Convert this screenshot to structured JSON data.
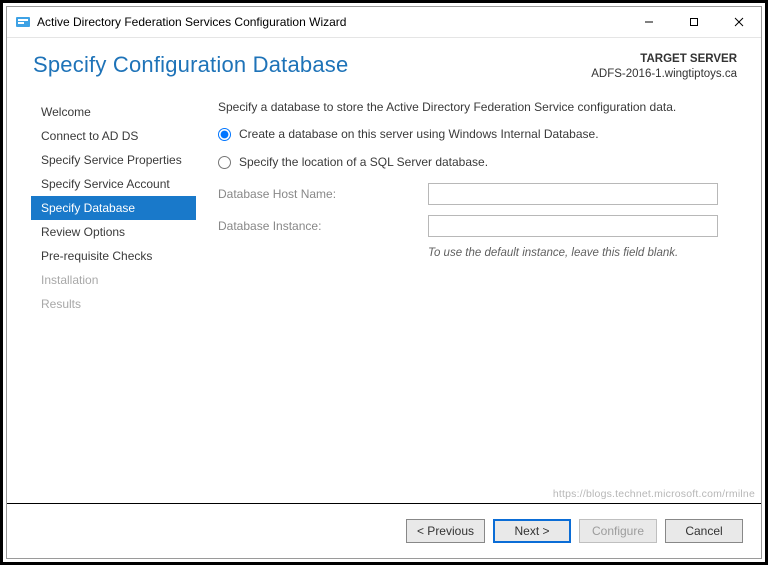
{
  "window": {
    "title": "Active Directory Federation Services Configuration Wizard"
  },
  "header": {
    "title": "Specify Configuration Database",
    "target_label": "TARGET SERVER",
    "target_value": "ADFS-2016-1.wingtiptoys.ca"
  },
  "sidebar": {
    "items": [
      {
        "label": "Welcome",
        "state": "normal"
      },
      {
        "label": "Connect to AD DS",
        "state": "normal"
      },
      {
        "label": "Specify Service Properties",
        "state": "normal"
      },
      {
        "label": "Specify Service Account",
        "state": "normal"
      },
      {
        "label": "Specify Database",
        "state": "selected"
      },
      {
        "label": "Review Options",
        "state": "normal"
      },
      {
        "label": "Pre-requisite Checks",
        "state": "normal"
      },
      {
        "label": "Installation",
        "state": "disabled"
      },
      {
        "label": "Results",
        "state": "disabled"
      }
    ]
  },
  "content": {
    "intro": "Specify a database to store the Active Directory Federation Service configuration data.",
    "option_wid": "Create a database on this server using Windows Internal Database.",
    "option_sql": "Specify the location of a SQL Server database.",
    "host_label": "Database Host Name:",
    "host_value": "",
    "instance_label": "Database Instance:",
    "instance_value": "",
    "instance_hint": "To use the default instance, leave this field blank."
  },
  "footer": {
    "previous": "< Previous",
    "next": "Next >",
    "configure": "Configure",
    "cancel": "Cancel"
  },
  "watermark": "https://blogs.technet.microsoft.com/rmilne"
}
